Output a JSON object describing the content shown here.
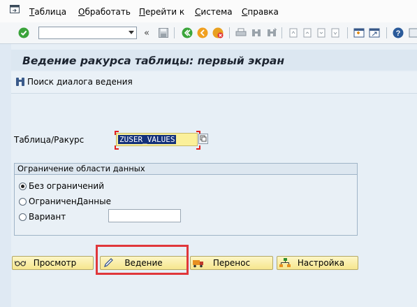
{
  "menu": {
    "items": [
      "Таблица",
      "Обработать",
      "Перейти к",
      "Система",
      "Справка"
    ]
  },
  "toolbar": {
    "command_value": "",
    "enter_icon": "check-icon",
    "save_icon": "save-icon"
  },
  "page": {
    "title": "Ведение ракурса таблицы: первый экран",
    "search_button": "Поиск диалога ведения"
  },
  "form": {
    "table_label": "Таблица/Ракурс",
    "table_value": "ZUSER_VALUES"
  },
  "restriction": {
    "title": "Ограничение области данных",
    "options": [
      "Без ограничений",
      "ОграниченДанные",
      "Вариант"
    ],
    "selected": "Без ограничений",
    "variant_value": ""
  },
  "actions": {
    "display": "Просмотр",
    "maintain": "Ведение",
    "transport": "Перенос",
    "customizing": "Настройка"
  },
  "colors": {
    "highlight": "#e0373b",
    "button_yellow": "#f6e68e",
    "background": "#e7eff6"
  }
}
